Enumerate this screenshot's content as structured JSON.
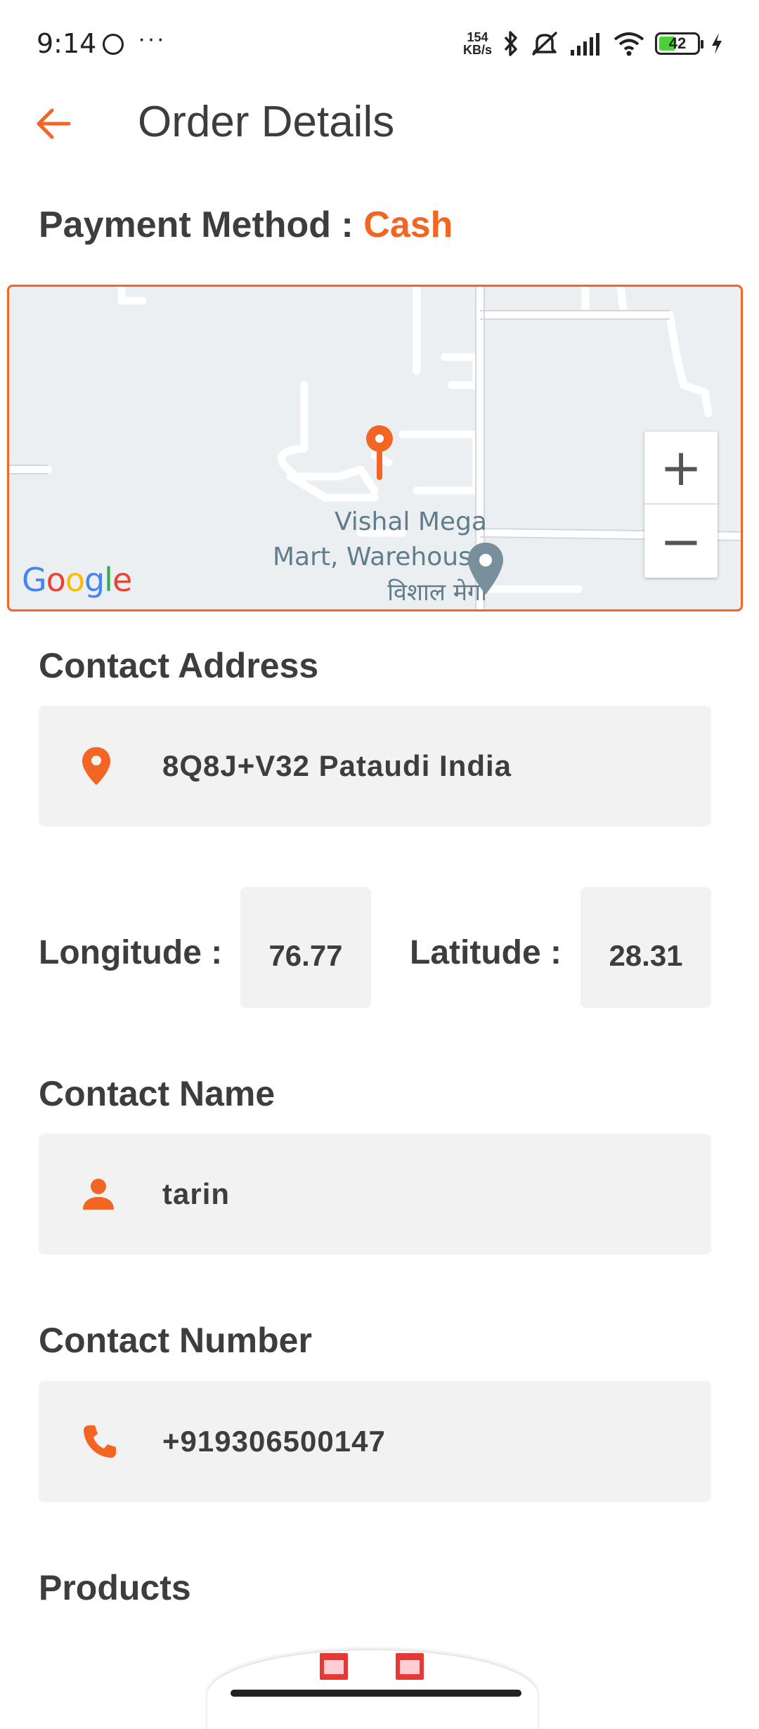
{
  "status_bar": {
    "time": "9:14",
    "more": "···",
    "net_speed_value": "154",
    "net_speed_unit": "KB/s",
    "battery": "42",
    "icons": [
      "face-icon",
      "bluetooth-icon",
      "mute-icon",
      "signal-icon",
      "wifi-icon",
      "battery-icon",
      "charging-icon"
    ]
  },
  "header": {
    "title": "Order Details",
    "back_icon": "arrow-left-icon"
  },
  "payment": {
    "label": "Payment Method : ",
    "value": "Cash"
  },
  "map": {
    "place_label_line1": "Vishal Mega",
    "place_label_line2": "Mart, Warehouse",
    "place_label_line3": "विशाल मेगा",
    "zoom_in": "+",
    "zoom_out": "−",
    "logo_letters": [
      "G",
      "o",
      "o",
      "g",
      "l",
      "e"
    ]
  },
  "contact_address": {
    "title": "Contact Address",
    "value": "8Q8J+V32 Pataudi  India",
    "icon": "location-pin-icon"
  },
  "coordinates": {
    "longitude_label": "Longitude :",
    "longitude_value": "76.77",
    "latitude_label": "Latitude :",
    "latitude_value": "28.31"
  },
  "contact_name": {
    "title": "Contact Name",
    "value": "tarin",
    "icon": "person-icon"
  },
  "contact_number": {
    "title": "Contact Number",
    "value": "+919306500147",
    "icon": "phone-icon"
  },
  "products": {
    "title": "Products"
  },
  "colors": {
    "accent": "#f26522",
    "text": "#3d3d3d",
    "field_bg": "#f2f2f2",
    "map_bg": "#eceff1"
  }
}
